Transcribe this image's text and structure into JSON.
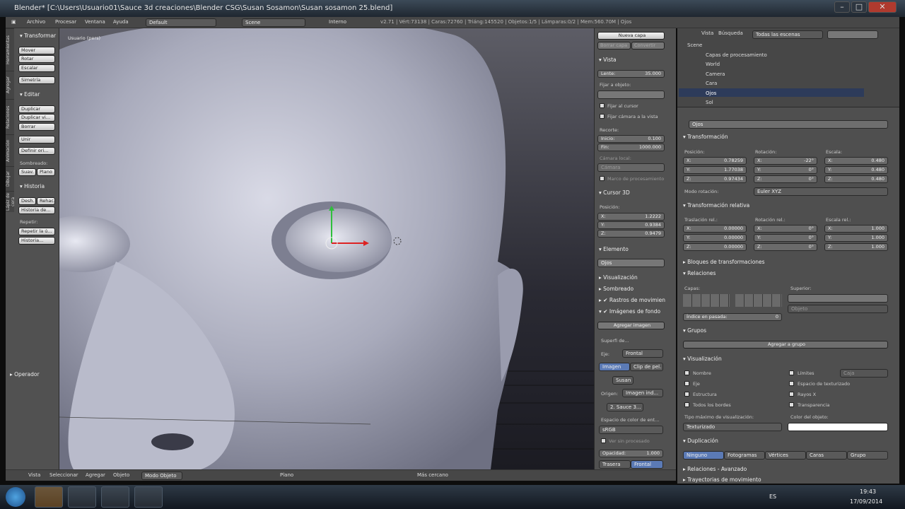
{
  "window": {
    "title": "Blender* [C:\\Users\\Usuario01\\Sauce 3d creaciones\\Blender CSG\\Susan Sosamon\\Susan sosamon 25.blend]",
    "min": "–",
    "max": "□",
    "close": "✕"
  },
  "topbar": {
    "menu": [
      "Archivo",
      "Procesar",
      "Ventana",
      "Ayuda"
    ],
    "layout": "Default",
    "scene": "Scene",
    "engine": "Interno",
    "stats": "v2.71 | Vért:73138 | Caras:72760 | Triáng:145520 | Objetos:1/5 | Lámparas:0/2 | Mem:560.70M | Ojos"
  },
  "toolshelf": {
    "tabs": [
      "Herramientas",
      "Agregar",
      "Relaciones",
      "Animación",
      "Dibujar",
      "Lápiz de cera"
    ],
    "transform_header": "▾ Transformar",
    "transform_buttons": [
      "Mover",
      "Rotar",
      "Escalar",
      "Simetría"
    ],
    "edit_header": "▾ Editar",
    "edit_buttons": [
      "Duplicar",
      "Duplicar vi...",
      "Borrar",
      "Unir",
      "Definir ori..."
    ],
    "shading_label": "Sombreado:",
    "shading_buttons": [
      "Suav.",
      "Plano"
    ],
    "history_header": "▾ Historia",
    "history_buttons": [
      "Desh.",
      "Rehac.",
      "Historia de..."
    ],
    "repeat_label": "Repetir:",
    "repeat_buttons": [
      "Repetir la ú...",
      "Historia..."
    ],
    "operator": "▸ Operador"
  },
  "viewport": {
    "view_label": "Usuario (pers)"
  },
  "npanel": {
    "top_buttons": [
      "Nueva capa",
      "Borrar capa",
      "Convertir"
    ],
    "view_header": "▾ Vista",
    "lens_label": "Lente:",
    "lens_value": "35.000",
    "lock_label": "Fijar a objeto:",
    "lock_cursor": "Fijar al cursor",
    "lock_camera": "Fijar cámara a la vista",
    "clip_label": "Recorte:",
    "clip_start_k": "Inicio:",
    "clip_start": "0.100",
    "clip_end_k": "Fin:",
    "clip_end": "1000.000",
    "local_cam": "Cámara local:",
    "camera": "Cámara",
    "render_border": "Marco de procesamiento",
    "cursor_header": "▾ Cursor 3D",
    "cursor_pos": "Posición:",
    "cx": "1.2222",
    "cy": "0.9384",
    "cz": "0.9479",
    "item_header": "▾ Elemento",
    "item_name": "Ojos",
    "display_header": "▸ Visualización",
    "shading_header": "▸ Sombreado",
    "motion_header": "▸ ✔ Rastros de movimien",
    "bg_header": "▾ ✔ Imágenes de fondo",
    "add_image": "Agregar imagen",
    "bg_item": "Superfi de...",
    "axis_label": "Eje:",
    "axis_value": "Frontal",
    "src_tabs": [
      "Imagen",
      "Clip de pel."
    ],
    "img_name": "Susan",
    "source_label": "Origen:",
    "source_value": "Imagen ind...",
    "file": "2. Sauce 3...",
    "colorspace_label": "Espacio de color de ent...",
    "colorspace": "sRGB",
    "premult": "Ver sin procesado",
    "opacity": "Opacidad:",
    "opacity_value": "1.000",
    "bottom_tabs": [
      "Trasera",
      "Frontal"
    ]
  },
  "vheader": {
    "items": [
      "Vista",
      "Seleccionar",
      "Agregar",
      "Objeto"
    ],
    "mode": "Modo Objeto",
    "pivot": "Plano",
    "snap": "Más cercano"
  },
  "outliner": {
    "menu": [
      "Vista",
      "Búsqueda"
    ],
    "filter": "Todas las escenas",
    "rows": [
      {
        "n": "Scene"
      },
      {
        "n": "Capas de procesamiento"
      },
      {
        "n": "World"
      },
      {
        "n": "Camera"
      },
      {
        "n": "Cara"
      },
      {
        "n": "Ojos"
      },
      {
        "n": "Sol"
      }
    ]
  },
  "props": {
    "name": "Ojos",
    "transform_header": "▾ Transformación",
    "loc_label": "Posición:",
    "rot_label": "Rotación:",
    "scale_label": "Escala:",
    "loc": [
      "0.78259",
      "1.77038",
      "0.97434"
    ],
    "rot": [
      "-22°",
      "0°",
      "0°"
    ],
    "scale": [
      "0.480",
      "0.480",
      "0.480"
    ],
    "rotmode_label": "Modo rotación:",
    "rotmode": "Euler XYZ",
    "delta_header": "▾ Transformación relativa",
    "dloc_label": "Traslación rel.:",
    "drot_label": "Rotación rel.:",
    "dscale_label": "Escala rel.:",
    "dloc": [
      "0.00000",
      "0.00000",
      "0.00000"
    ],
    "drot": [
      "0°",
      "0°",
      "0°"
    ],
    "dscale": [
      "1.000",
      "1.000",
      "1.000"
    ],
    "axes": [
      "X:",
      "Y:",
      "Z:"
    ],
    "blocks_header": "▸ Bloques de transformaciones",
    "relations_header": "▾ Relaciones",
    "layers_label": "Capas:",
    "parent_label": "Superior:",
    "object_label": "Objeto",
    "pass_index": "Índice en pasada:",
    "pass_value": "0",
    "groups_header": "▾ Grupos",
    "add_group": "Agregar a grupo",
    "display_header": "▾ Visualización",
    "display_left": [
      "Nombre",
      "Eje",
      "Estructura",
      "Todos los bordes"
    ],
    "display_right": [
      "Límites",
      "Espacio de texturizado",
      "Rayos X",
      "Transparencia"
    ],
    "bounds_type": "Caja",
    "maxdraw_label": "Tipo máximo de visualización:",
    "maxdraw": "Texturizado",
    "color_label": "Color del objeto:",
    "dup_header": "▾ Duplicación",
    "dup_buttons": [
      "Ninguno",
      "Fotogramas",
      "Vértices",
      "Caras",
      "Grupo"
    ],
    "adv_relations": "▸ Relaciones - Avanzado",
    "motion_paths": "▸ Trayectorias de movimiento"
  },
  "taskbar": {
    "lang": "ES",
    "time": "19:43",
    "date": "17/09/2014"
  }
}
